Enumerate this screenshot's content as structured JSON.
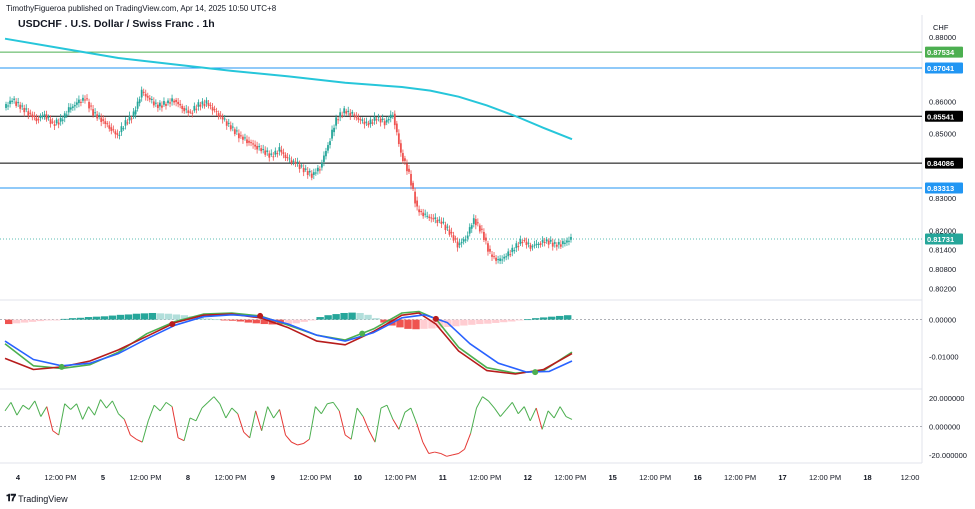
{
  "header": {
    "published": "TimothyFigueroa published on TradingView.com, Apr 14, 2025 10:50 UTC+8",
    "title": "USDCHF . U.S. Dollar / Swiss Franc . 1h"
  },
  "footer": {
    "brand": "TradingView"
  },
  "colors": {
    "up": "#26a69a",
    "down": "#ef5350",
    "ma": "#26c6da",
    "green": "#4caf50",
    "darkred": "#b71c1c",
    "blue": "#2962ff"
  },
  "chart_data": [
    {
      "type": "candlestick",
      "currency": "CHF",
      "ylim": [
        0.799,
        0.8822
      ],
      "y_ticks": [
        "0.88000",
        "0.86000",
        "0.85000",
        "0.83000",
        "0.82000",
        "0.81400",
        "0.80800",
        "0.80200"
      ],
      "y_tick_values": [
        0.88,
        0.86,
        0.85,
        0.83,
        0.82,
        0.814,
        0.808,
        0.802
      ],
      "x_ticks": [
        "4",
        "12:00 PM",
        "5",
        "12:00 PM",
        "8",
        "12:00 PM",
        "9",
        "12:00 PM",
        "10",
        "12:00 PM",
        "11",
        "12:00 PM",
        "12",
        "12:00 PM",
        "15",
        "12:00 PM",
        "16",
        "12:00 PM",
        "17",
        "12:00 PM",
        "18",
        "12:00"
      ],
      "x_ticks_bold": [
        true,
        false,
        true,
        false,
        true,
        false,
        true,
        false,
        true,
        false,
        true,
        false,
        true,
        false,
        true,
        false,
        true,
        false,
        true,
        false,
        true,
        false
      ],
      "horizontal_levels": [
        {
          "label": "0.87534",
          "value": 0.87534,
          "color": "#4caf50"
        },
        {
          "label": "0.87041",
          "value": 0.87041,
          "color": "#2196f3"
        },
        {
          "label": "0.85541",
          "value": 0.85541,
          "color": "#000000"
        },
        {
          "label": "0.84086",
          "value": 0.84086,
          "color": "#000000"
        },
        {
          "label": "0.83313",
          "value": 0.83313,
          "color": "#2196f3"
        },
        {
          "label": "0.81731",
          "value": 0.81731,
          "color": "#26a69a"
        }
      ],
      "last_price": 0.81731,
      "close_path": [
        0.858,
        0.8605,
        0.8585,
        0.8565,
        0.8545,
        0.856,
        0.853,
        0.854,
        0.8575,
        0.8595,
        0.861,
        0.8565,
        0.8545,
        0.852,
        0.8495,
        0.8535,
        0.856,
        0.863,
        0.8605,
        0.8585,
        0.8595,
        0.8605,
        0.858,
        0.8565,
        0.859,
        0.8595,
        0.857,
        0.8545,
        0.852,
        0.8495,
        0.8478,
        0.8462,
        0.8448,
        0.843,
        0.845,
        0.842,
        0.841,
        0.8388,
        0.8372,
        0.8395,
        0.8465,
        0.8545,
        0.857,
        0.856,
        0.854,
        0.853,
        0.855,
        0.8535,
        0.8562,
        0.844,
        0.8375,
        0.8265,
        0.8245,
        0.8235,
        0.8225,
        0.8195,
        0.8155,
        0.8175,
        0.8235,
        0.8195,
        0.8125,
        0.8105,
        0.812,
        0.8145,
        0.817,
        0.815,
        0.816,
        0.8168,
        0.8155,
        0.8158,
        0.8175
      ],
      "moving_average": [
        [
          0.0,
          0.8795
        ],
        [
          0.1,
          0.8765
        ],
        [
          0.2,
          0.8735
        ],
        [
          0.3,
          0.8715
        ],
        [
          0.4,
          0.8695
        ],
        [
          0.5,
          0.8678
        ],
        [
          0.6,
          0.8658
        ],
        [
          0.7,
          0.8645
        ],
        [
          0.75,
          0.8634
        ],
        [
          0.8,
          0.8615
        ],
        [
          0.85,
          0.8588
        ],
        [
          0.9,
          0.8555
        ],
        [
          0.95,
          0.8518
        ],
        [
          1.0,
          0.8483
        ]
      ]
    },
    {
      "type": "histogram+line",
      "ylim": [
        -0.0185,
        0.0045
      ],
      "y_ticks": [
        "0.00000",
        "-0.01000"
      ],
      "y_tick_values": [
        0,
        -0.01
      ],
      "histogram": [
        -0.0012,
        -0.001,
        -0.0008,
        -0.0006,
        -0.0004,
        -0.0002,
        -0.0001,
        0.0002,
        0.0004,
        0.0005,
        0.0007,
        0.0008,
        0.0009,
        0.0011,
        0.0013,
        0.0014,
        0.0016,
        0.0017,
        0.0018,
        0.0017,
        0.0016,
        0.0014,
        0.0012,
        0.0009,
        0.0006,
        0.0003,
        0.0001,
        -0.0001,
        -0.0003,
        -0.0005,
        -0.0008,
        -0.001,
        -0.0012,
        -0.0013,
        -0.0013,
        -0.0012,
        -0.001,
        -0.0006,
        -0.0001,
        0.0007,
        0.0012,
        0.0015,
        0.0018,
        0.0019,
        0.0018,
        0.0013,
        0.0004,
        -0.0008,
        -0.0016,
        -0.0021,
        -0.0025,
        -0.0026,
        -0.0025,
        -0.0024,
        -0.0022,
        -0.002,
        -0.0018,
        -0.0016,
        -0.0014,
        -0.0012,
        -0.0011,
        -0.0009,
        -0.0007,
        -0.0005,
        -0.0002,
        0.0001,
        0.0004,
        0.0006,
        0.0008,
        0.001,
        0.0012
      ],
      "series": [
        {
          "color": "#4caf50",
          "points": [
            [
              0,
              -0.0065
            ],
            [
              0.05,
              -0.0125
            ],
            [
              0.1,
              -0.0132
            ],
            [
              0.15,
              -0.0122
            ],
            [
              0.2,
              -0.0088
            ],
            [
              0.25,
              -0.0038
            ],
            [
              0.3,
              -0.0005
            ],
            [
              0.35,
              0.0015
            ],
            [
              0.4,
              0.0018
            ],
            [
              0.45,
              0.001
            ],
            [
              0.5,
              -0.0015
            ],
            [
              0.55,
              -0.0042
            ],
            [
              0.6,
              -0.0055
            ],
            [
              0.65,
              -0.0025
            ],
            [
              0.7,
              0.0018
            ],
            [
              0.73,
              0.0022
            ],
            [
              0.76,
              0.0002
            ],
            [
              0.8,
              -0.0075
            ],
            [
              0.85,
              -0.013
            ],
            [
              0.9,
              -0.0145
            ],
            [
              0.95,
              -0.0138
            ],
            [
              1.0,
              -0.0088
            ]
          ]
        },
        {
          "color": "#b71c1c",
          "points": [
            [
              0,
              -0.0105
            ],
            [
              0.05,
              -0.0135
            ],
            [
              0.1,
              -0.0128
            ],
            [
              0.15,
              -0.0112
            ],
            [
              0.2,
              -0.0082
            ],
            [
              0.25,
              -0.0045
            ],
            [
              0.3,
              -0.0008
            ],
            [
              0.35,
              0.0012
            ],
            [
              0.4,
              0.0015
            ],
            [
              0.45,
              0.0005
            ],
            [
              0.5,
              -0.0022
            ],
            [
              0.55,
              -0.0058
            ],
            [
              0.6,
              -0.0068
            ],
            [
              0.65,
              -0.0032
            ],
            [
              0.7,
              0.0012
            ],
            [
              0.73,
              0.0018
            ],
            [
              0.76,
              -0.0012
            ],
            [
              0.8,
              -0.0085
            ],
            [
              0.85,
              -0.0138
            ],
            [
              0.9,
              -0.0147
            ],
            [
              0.95,
              -0.0135
            ],
            [
              1.0,
              -0.0092
            ]
          ]
        },
        {
          "color": "#2962ff",
          "points": [
            [
              0,
              -0.0058
            ],
            [
              0.05,
              -0.0108
            ],
            [
              0.1,
              -0.0125
            ],
            [
              0.15,
              -0.0118
            ],
            [
              0.2,
              -0.0092
            ],
            [
              0.25,
              -0.0052
            ],
            [
              0.3,
              -0.0015
            ],
            [
              0.35,
              0.0008
            ],
            [
              0.4,
              0.0013
            ],
            [
              0.45,
              0.0008
            ],
            [
              0.5,
              -0.0012
            ],
            [
              0.55,
              -0.0042
            ],
            [
              0.6,
              -0.0058
            ],
            [
              0.65,
              -0.0035
            ],
            [
              0.7,
              0.0005
            ],
            [
              0.74,
              0.0013
            ],
            [
              0.78,
              -0.0008
            ],
            [
              0.82,
              -0.0065
            ],
            [
              0.87,
              -0.0118
            ],
            [
              0.92,
              -0.0142
            ],
            [
              0.96,
              -0.014
            ],
            [
              1.0,
              -0.0112
            ]
          ]
        }
      ],
      "markers": [
        {
          "x": 0.1,
          "y": -0.0128,
          "color": "#4caf50"
        },
        {
          "x": 0.295,
          "y": -0.0012,
          "color": "#b71c1c"
        },
        {
          "x": 0.45,
          "y": 0.001,
          "color": "#b71c1c"
        },
        {
          "x": 0.63,
          "y": -0.0038,
          "color": "#4caf50"
        },
        {
          "x": 0.76,
          "y": 0.0002,
          "color": "#b71c1c"
        },
        {
          "x": 0.935,
          "y": -0.0142,
          "color": "#4caf50"
        }
      ]
    },
    {
      "type": "line",
      "ylim": [
        -25,
        25
      ],
      "y_ticks": [
        "20.000000",
        "0.000000",
        "-20.000000"
      ],
      "y_tick_values": [
        20,
        0,
        -20
      ],
      "values": [
        11,
        17,
        8,
        15,
        12,
        18,
        7,
        14,
        -3,
        -6,
        16,
        12,
        16,
        5,
        14,
        8,
        19,
        13,
        18,
        9,
        5,
        -6,
        -9,
        -11,
        4,
        15,
        11,
        17,
        14,
        -8,
        -10,
        6,
        4,
        13,
        17,
        21,
        16,
        6,
        13,
        9,
        -4,
        -8,
        11,
        -3,
        14,
        6,
        12,
        -6,
        -11,
        -13,
        -12,
        -9,
        14,
        9,
        16,
        17,
        11,
        -6,
        -9,
        13,
        7,
        -3,
        -11,
        13,
        15,
        5,
        -2,
        10,
        13,
        2,
        -11,
        -19,
        -18,
        -19,
        -21,
        -20,
        -19,
        -16,
        -5,
        13,
        21,
        18,
        13,
        7,
        12,
        17,
        9,
        14,
        4,
        13,
        -2,
        11,
        6,
        14,
        7,
        5
      ]
    }
  ]
}
